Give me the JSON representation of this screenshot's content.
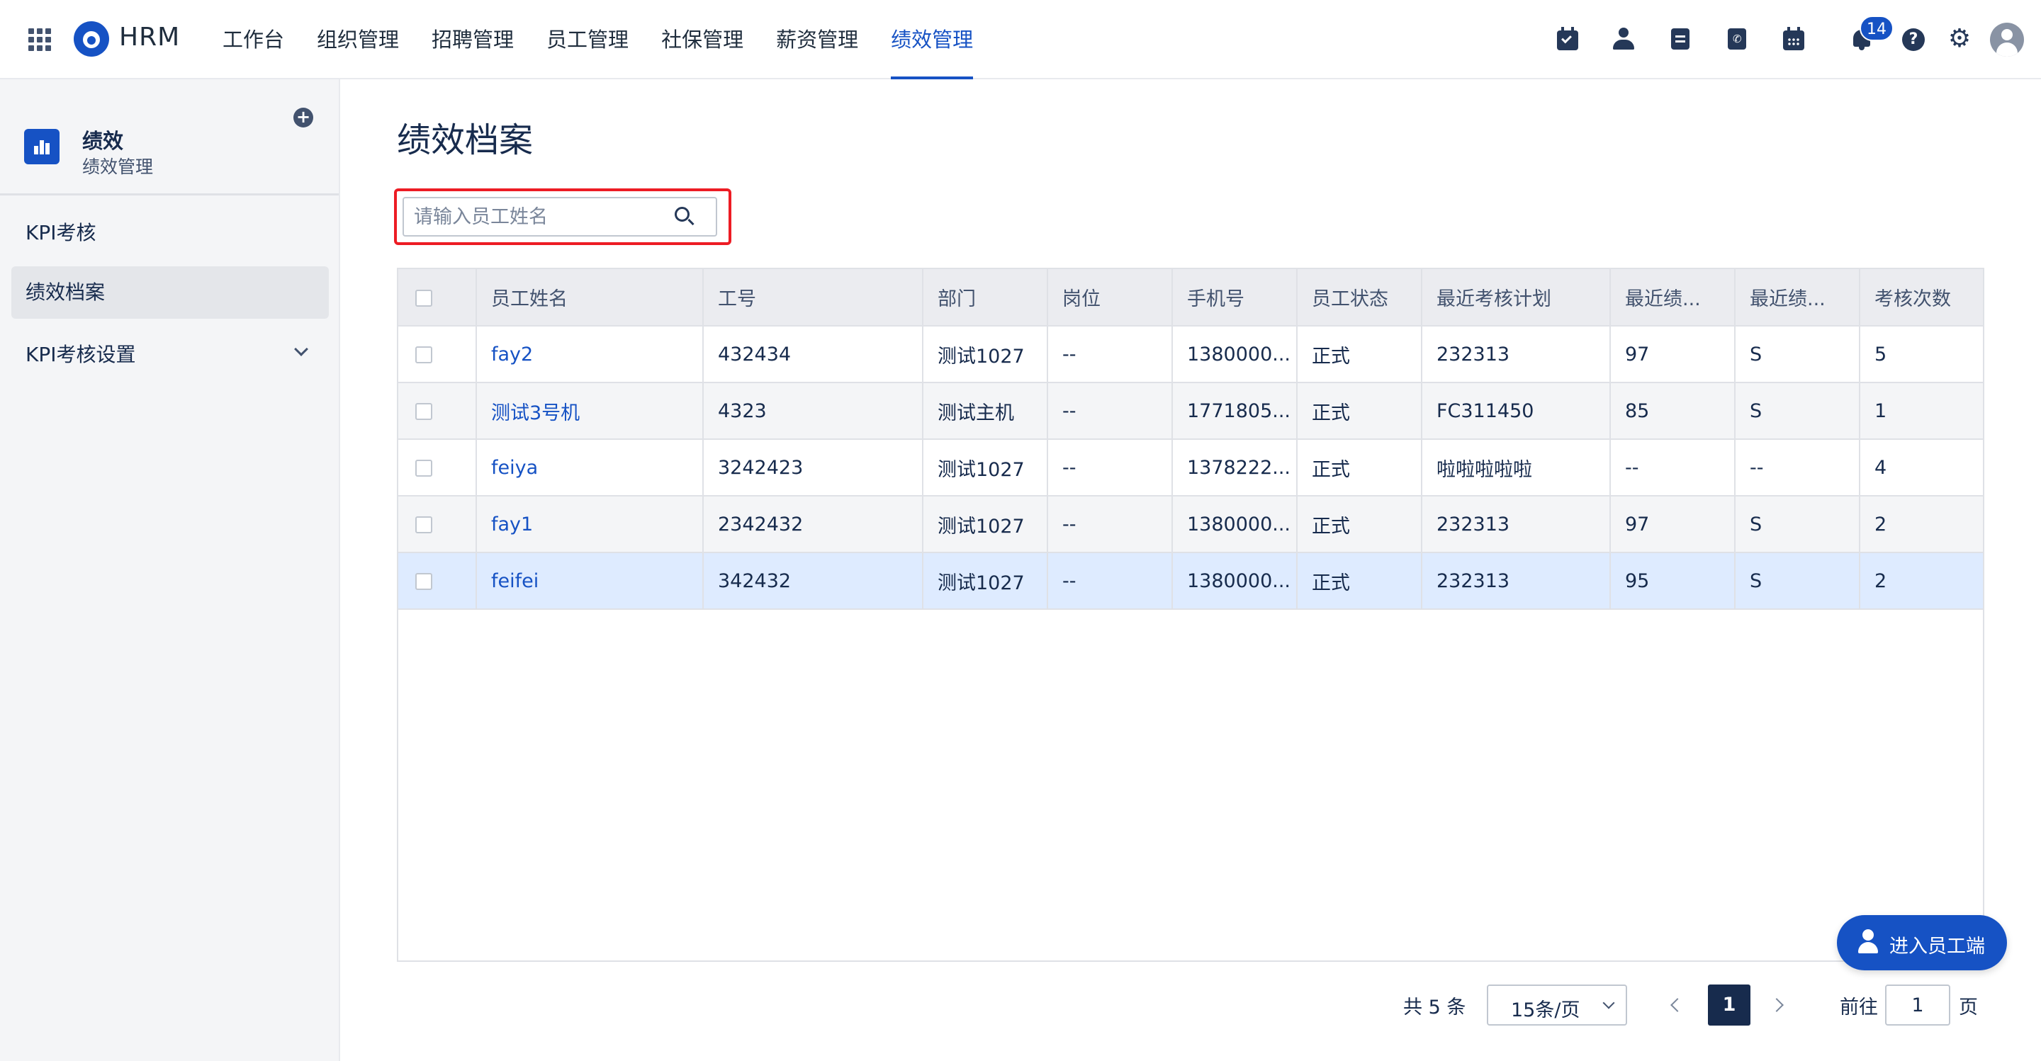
{
  "app": {
    "brand": "HRM"
  },
  "nav": {
    "items": [
      "工作台",
      "组织管理",
      "招聘管理",
      "员工管理",
      "社保管理",
      "薪资管理",
      "绩效管理"
    ],
    "active": "绩效管理"
  },
  "toolbar": {
    "notification_count": "14",
    "icons": [
      "calendar-check-icon",
      "user-icon",
      "document-icon",
      "phone-icon",
      "calendar-icon",
      "bell-icon",
      "help-icon",
      "gear-icon",
      "avatar"
    ]
  },
  "sidebar": {
    "title": "绩效",
    "subtitle": "绩效管理",
    "items": [
      {
        "label": "KPI考核"
      },
      {
        "label": "绩效档案",
        "active": true
      },
      {
        "label": "KPI考核设置",
        "expandable": true
      }
    ]
  },
  "main": {
    "page_title": "绩效档案",
    "search": {
      "placeholder": "请输入员工姓名",
      "value": ""
    },
    "table": {
      "columns": [
        "员工姓名",
        "工号",
        "部门",
        "岗位",
        "手机号",
        "员工状态",
        "最近考核计划",
        "最近绩...",
        "最近绩...",
        "考核次数"
      ],
      "rows": [
        [
          "fay2",
          "432434",
          "测试1027",
          "--",
          "1380000...",
          "正式",
          "232313",
          "97",
          "S",
          "5"
        ],
        [
          "测试3号机",
          "4323",
          "测试主机",
          "--",
          "1771805...",
          "正式",
          "FC311450",
          "85",
          "S",
          "1"
        ],
        [
          "feiya",
          "3242423",
          "测试1027",
          "--",
          "1378222...",
          "正式",
          "啦啦啦啦啦",
          "--",
          "--",
          "4"
        ],
        [
          "fay1",
          "2342432",
          "测试1027",
          "--",
          "1380000...",
          "正式",
          "232313",
          "97",
          "S",
          "2"
        ],
        [
          "feifei",
          "342432",
          "测试1027",
          "--",
          "1380000...",
          "正式",
          "232313",
          "95",
          "S",
          "2"
        ]
      ],
      "selected_row": 4
    },
    "pagination": {
      "total": "共 5 条",
      "page_size": "15条/页",
      "current_page": "1",
      "goto_label": "前往",
      "goto_value": "1",
      "goto_suffix": "页"
    }
  },
  "float_button": {
    "label": "进入员工端"
  },
  "colors": {
    "accent": "#1652c4",
    "highlight": "#ed1c24",
    "selected_row": "#deebff"
  }
}
